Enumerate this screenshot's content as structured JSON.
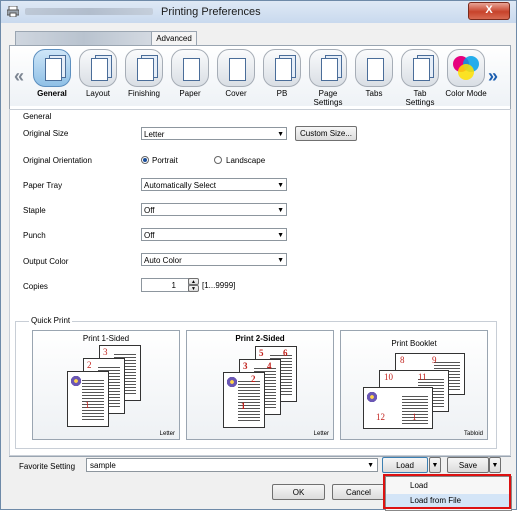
{
  "window": {
    "title": "Printing Preferences",
    "close": "X"
  },
  "tabs": {
    "advanced": "Advanced"
  },
  "ribbon": {
    "items": [
      {
        "label": "General",
        "icon": "general-icon"
      },
      {
        "label": "Layout",
        "icon": "layout-icon"
      },
      {
        "label": "Finishing",
        "icon": "finishing-icon"
      },
      {
        "label": "Paper",
        "icon": "paper-icon"
      },
      {
        "label": "Cover",
        "icon": "cover-icon"
      },
      {
        "label": "PB",
        "icon": "pb-icon"
      },
      {
        "label": "Page Settings",
        "icon": "page-settings-icon"
      },
      {
        "label": "Tabs",
        "icon": "tabs-icon"
      },
      {
        "label": "Tab Settings",
        "icon": "tab-settings-icon"
      },
      {
        "label": "Color Mode",
        "icon": "color-mode-icon"
      }
    ],
    "left_arrow": "«",
    "right_arrow": "»"
  },
  "general": {
    "group_label": "General",
    "original_size": {
      "label": "Original Size",
      "value": "Letter",
      "button": "Custom Size..."
    },
    "orientation": {
      "label": "Original Orientation",
      "portrait": "Portrait",
      "landscape": "Landscape"
    },
    "paper_tray": {
      "label": "Paper Tray",
      "value": "Automatically Select"
    },
    "staple": {
      "label": "Staple",
      "value": "Off"
    },
    "punch": {
      "label": "Punch",
      "value": "Off"
    },
    "output_color": {
      "label": "Output Color",
      "value": "Auto Color"
    },
    "copies": {
      "label": "Copies",
      "value": "1",
      "range": "[1...9999]"
    }
  },
  "quick_print": {
    "label": "Quick Print",
    "cards": [
      {
        "title": "Print 1-Sided",
        "size": "Letter",
        "pages": [
          "3",
          "2",
          "1"
        ]
      },
      {
        "title": "Print 2-Sided",
        "size": "Letter",
        "pages": [
          "5",
          "6",
          "3",
          "4",
          "2",
          "1"
        ]
      },
      {
        "title": "Print Booklet",
        "size": "Tabloid",
        "pages": [
          "8",
          "9",
          "10",
          "11",
          "12",
          "1"
        ]
      }
    ]
  },
  "footer": {
    "favorite_label": "Favorite Setting",
    "favorite_value": "sample",
    "load": "Load",
    "save": "Save",
    "ok": "OK",
    "cancel": "Cancel",
    "menu": [
      "Load",
      "Load from File"
    ]
  }
}
